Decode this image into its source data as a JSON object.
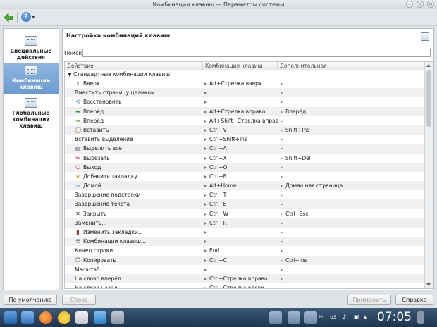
{
  "window": {
    "title": "Комбинации клавиш — Параметры системы"
  },
  "toolbar": {
    "back_icon": "back-arrow-icon",
    "help_icon": "help-icon",
    "help_label": "?"
  },
  "sidebar": {
    "items": [
      {
        "label": "Специальные действия",
        "icon": "keyboard-icon",
        "active": false
      },
      {
        "label": "Комбинации клавиш",
        "icon": "keyboard-icon",
        "active": true
      },
      {
        "label": "Глобальные комбинации клавиш",
        "icon": "keyboard-icon",
        "active": false
      }
    ]
  },
  "panel": {
    "title": "Настройка комбинаций клавиш",
    "search_label": "Поиск:",
    "search_value": ""
  },
  "table": {
    "columns": [
      "Действие",
      "Комбинация клавиш",
      "Дополнительная"
    ],
    "group": "Стандартные комбинации клавиш",
    "rows": [
      {
        "action": "Вверх",
        "icon": "up-arrow-icon",
        "shortcut": "Alt+Стрелка вверх",
        "alternate": ""
      },
      {
        "action": "Вместить страницу целиком",
        "icon": "",
        "shortcut": "",
        "alternate": ""
      },
      {
        "action": "Восстановить",
        "icon": "restore-icon",
        "shortcut": "",
        "alternate": ""
      },
      {
        "action": "Вперёд",
        "icon": "forward-arrow-icon",
        "shortcut": "Alt+Стрелка вправо",
        "alternate": "Вперёд"
      },
      {
        "action": "Вперёд",
        "icon": "forward-arrow-icon",
        "shortcut": "Alt+Shift+Стрелка вправо",
        "alternate": ""
      },
      {
        "action": "Вставить",
        "icon": "paste-icon",
        "shortcut": "Ctrl+V",
        "alternate": "Shift+Ins"
      },
      {
        "action": "Вставить выделение",
        "icon": "",
        "shortcut": "Ctrl+Shift+Ins",
        "alternate": ""
      },
      {
        "action": "Выделить все",
        "icon": "select-all-icon",
        "shortcut": "Ctrl+A",
        "alternate": ""
      },
      {
        "action": "Вырезать",
        "icon": "scissors-icon",
        "shortcut": "Ctrl+X",
        "alternate": "Shift+Del"
      },
      {
        "action": "Выход",
        "icon": "quit-icon",
        "shortcut": "Ctrl+Q",
        "alternate": ""
      },
      {
        "action": "Добавить закладку",
        "icon": "bookmark-star-icon",
        "shortcut": "Ctrl+B",
        "alternate": ""
      },
      {
        "action": "Домой",
        "icon": "home-icon",
        "shortcut": "Alt+Home",
        "alternate": "Домашняя страница"
      },
      {
        "action": "Завершение подстроки",
        "icon": "",
        "shortcut": "Ctrl+T",
        "alternate": ""
      },
      {
        "action": "Завершение текста",
        "icon": "",
        "shortcut": "Ctrl+E",
        "alternate": ""
      },
      {
        "action": "Закрыть",
        "icon": "close-x-icon",
        "shortcut": "Ctrl+W",
        "alternate": "Ctrl+Esc"
      },
      {
        "action": "Заменить...",
        "icon": "",
        "shortcut": "Ctrl+R",
        "alternate": ""
      },
      {
        "action": "Изменить закладки...",
        "icon": "bookmarks-icon",
        "shortcut": "",
        "alternate": ""
      },
      {
        "action": "Комбинации клавиш...",
        "icon": "tools-icon",
        "shortcut": "",
        "alternate": ""
      },
      {
        "action": "Конец строки",
        "icon": "",
        "shortcut": "End",
        "alternate": ""
      },
      {
        "action": "Копировать",
        "icon": "copy-icon",
        "shortcut": "Ctrl+C",
        "alternate": "Ctrl+Ins"
      },
      {
        "action": "Масштаб...",
        "icon": "",
        "shortcut": "",
        "alternate": ""
      },
      {
        "action": "На слово вперёд",
        "icon": "",
        "shortcut": "Ctrl+Стрелка вправо",
        "alternate": ""
      },
      {
        "action": "На слово назад",
        "icon": "",
        "shortcut": "Ctrl+Стрелка влево",
        "alternate": ""
      }
    ]
  },
  "buttons": {
    "defaults": "По умолчанию",
    "reset": "Сброс",
    "apply": "Применить",
    "help": "Справка"
  },
  "taskbar": {
    "tray_lang": "us",
    "clock": "07:05"
  }
}
